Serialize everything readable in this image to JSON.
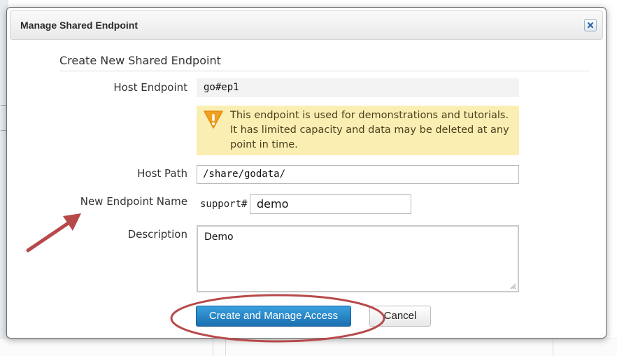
{
  "dialog": {
    "title": "Manage Shared Endpoint",
    "close_icon": "close-icon"
  },
  "form": {
    "section_title": "Create New Shared Endpoint",
    "host_endpoint": {
      "label": "Host Endpoint",
      "value": "go#ep1"
    },
    "warning": {
      "icon": "warning-icon",
      "text": "This endpoint is used for demonstrations and tutorials. It has limited capacity and data may be deleted at any point in time."
    },
    "host_path": {
      "label": "Host Path",
      "value": "/share/godata/"
    },
    "endpoint_name": {
      "label": "New Endpoint Name",
      "prefix": "support#",
      "value": "demo"
    },
    "description": {
      "label": "Description",
      "value": "Demo"
    }
  },
  "actions": {
    "primary_label": "Create and Manage Access",
    "cancel_label": "Cancel"
  },
  "colors": {
    "primary_button": "#2586c9",
    "warning_background": "#fbeeb3",
    "warning_icon": "#f0a020",
    "annotation": "#b8494a"
  }
}
